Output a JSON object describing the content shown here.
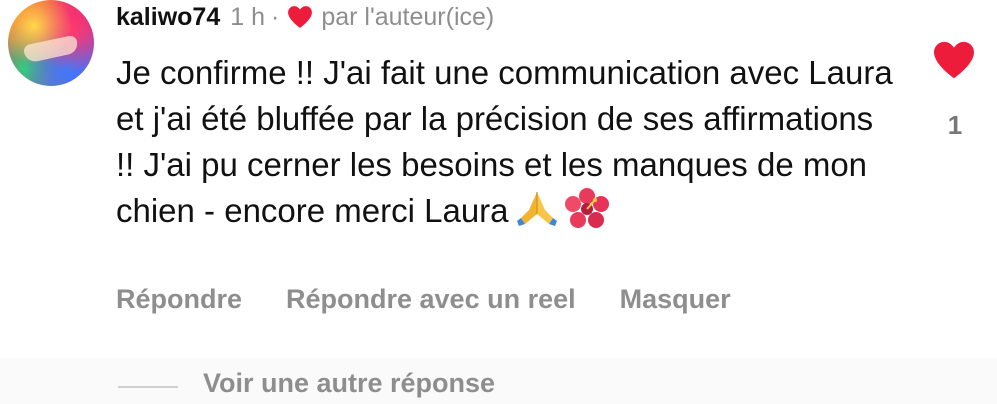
{
  "comment": {
    "username": "kaliwo74",
    "time": "1 h",
    "separator": "·",
    "liked_by_author_label": "par l'auteur(ice)",
    "text": "Je confirme !! J'ai fait une communication avec Laura et j'ai été bluffée par la précision de ses affirmations !! J'ai pu cerner les besoins et les manques de mon chien - encore merci Laura",
    "emojis": [
      "folded-hands",
      "hibiscus"
    ],
    "like_count": "1",
    "heart_color": "#ed1c3a"
  },
  "actions": {
    "reply": "Répondre",
    "reply_with_reel": "Répondre avec un reel",
    "hide": "Masquer"
  },
  "replies": {
    "view_more": "Voir une autre réponse"
  }
}
